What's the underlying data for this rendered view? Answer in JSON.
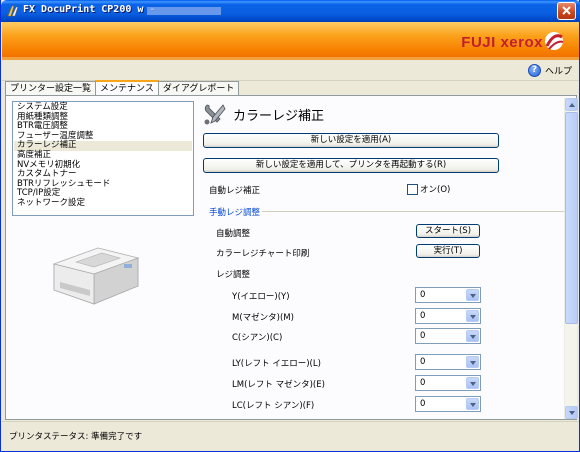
{
  "window": {
    "title": "FX DocuPrint CP200 w -"
  },
  "brand": {
    "logo": "FUJI xerox"
  },
  "help": {
    "label": "ヘルプ"
  },
  "tabs": [
    {
      "label": "プリンター設定一覧",
      "active": false
    },
    {
      "label": "メンテナンス",
      "active": true
    },
    {
      "label": "ダイアグレポート",
      "active": false
    }
  ],
  "nav": {
    "items": [
      "システム設定",
      "用紙種類調整",
      "BTR電圧調整",
      "フューザー温度調整",
      "カラーレジ補正",
      "高度補正",
      "NVメモリ初期化",
      "カスタムトナー",
      "BTRリフレッシュモード",
      "TCP/IP設定",
      "ネットワーク設定"
    ],
    "selected_index": 4
  },
  "main": {
    "title": "カラーレジ補正",
    "apply_button": "新しい設定を適用(A)",
    "apply_restart_button": "新しい設定を適用して、プリンタを再起動する(R)",
    "auto_reg_label": "自動レジ補正",
    "auto_reg_checkbox": "オン(O)",
    "manual_group": "手動レジ調整",
    "auto_adjust_label": "自動調整",
    "start_button": "スタート(S)",
    "chart_print_label": "カラーレジチャート印刷",
    "run_button": "実行(T)",
    "reg_adjust_label": "レジ調整",
    "registrations": [
      {
        "label": "Y(イエロー)(Y)",
        "value": "0"
      },
      {
        "label": "M(マゼンタ)(M)",
        "value": "0"
      },
      {
        "label": "C(シアン)(C)",
        "value": "0"
      },
      {
        "label": "LY(レフト イエロー)(L)",
        "value": "0"
      },
      {
        "label": "LM(レフト マゼンタ)(E)",
        "value": "0"
      },
      {
        "label": "LC(レフト シアン)(F)",
        "value": "0"
      }
    ]
  },
  "status": {
    "text": "プリンタステータス: 準備完了です"
  }
}
